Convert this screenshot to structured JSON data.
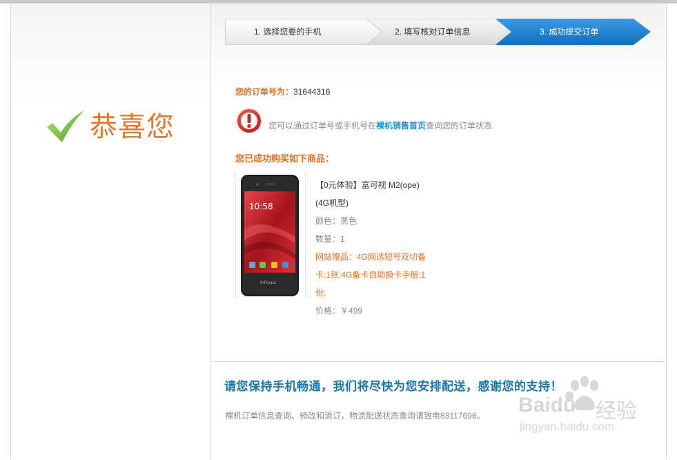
{
  "steps": [
    {
      "label": "1.  选择您要的手机",
      "active": false
    },
    {
      "label": "2.  填写核对订单信息",
      "active": false
    },
    {
      "label": "3.  成功提交订单",
      "active": true
    }
  ],
  "congrats": {
    "text": "恭喜您",
    "icon": "checkmark-icon"
  },
  "order": {
    "label": "您的订单号为：",
    "number": "31644316"
  },
  "notice": {
    "icon": "exclamation-icon",
    "prefix": "您可以通过订单号或手机号在",
    "link": "裸机销售首页",
    "suffix": "查询您的订单状态"
  },
  "bought_title": "您已成功购买如下商品：",
  "product": {
    "image": "phone-image",
    "screen_time": "10:58",
    "brand": "InFocus",
    "name": "【0元体验】富可视 M2(ope)",
    "model": "(4G机型)",
    "color": "颜色：黑色",
    "quantity": "数量：1",
    "gift_line1": "网站赠品：4G网选短号双切备",
    "gift_line2": "卡:1张;4G备卡自助换卡手册:1",
    "gift_line3": "份;",
    "price": "价格：￥499"
  },
  "bottom": {
    "title": "请您保持手机畅通，我们将尽快为您安排配送，感谢您的支持！",
    "text": "裸机订单信息查询、修改和退订，物流配送状态查询请致电83117696。"
  },
  "watermark": {
    "brand": "Baidu",
    "cn": "经验",
    "url": "jingyan.baidu.com"
  },
  "colors": {
    "accent_orange": "#e06f1f",
    "accent_blue": "#1677b3",
    "step_active": "#1a7fd0"
  }
}
